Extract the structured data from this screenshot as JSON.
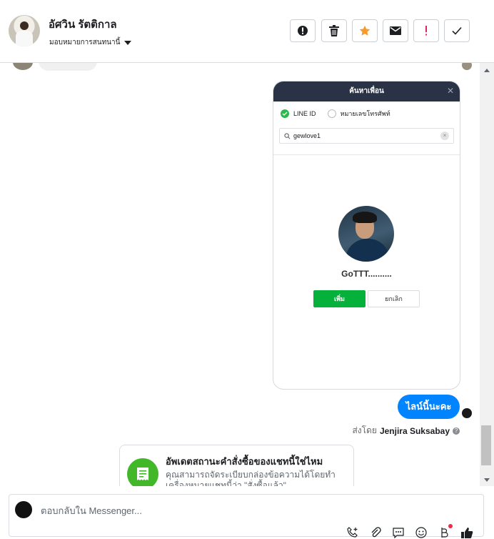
{
  "header": {
    "contact_name": "อัศวิน รัตติกาล",
    "assign_label": "มอบหมายการสนทนานี้",
    "toolbar": {
      "spam_icon": "alert-circle-icon",
      "delete_icon": "trash-icon",
      "star_icon": "star-icon",
      "mail_icon": "envelope-icon",
      "important_icon": "exclamation-icon",
      "done_icon": "checkmark-icon",
      "star_color": "#f79a2a",
      "important_color": "#e0245e"
    }
  },
  "screenshot": {
    "title": "ค้นหาเพื่อน",
    "option_line_id": "LINE ID",
    "option_phone": "หมายเลขโทรศัพท์",
    "search_value": "gewlove1",
    "profile_name": "GoTTT..........",
    "add_label": "เพิ่ม",
    "cancel_label": "ยกเลิก",
    "add_color": "#06b13b"
  },
  "messages": [
    {
      "text": "ไลน์นี้นะคะ",
      "bubble_color": "#0084ff"
    }
  ],
  "sent_by": {
    "prefix": "ส่งโดย",
    "name": "Jenjira Suksabay"
  },
  "order_card": {
    "title": "อัพเดตสถานะคำสั่งซื้อของแชทนี้ใช่ไหม",
    "description": "คุณสามารถจัดระเบียบกล่องข้อความได้โดยทำเครื่องหมายแชทนี้ว่า \"สั่งซื้อแล้ว\"",
    "icon_color": "#42b72a"
  },
  "composer": {
    "placeholder": "ตอบกลับใน Messenger..."
  }
}
